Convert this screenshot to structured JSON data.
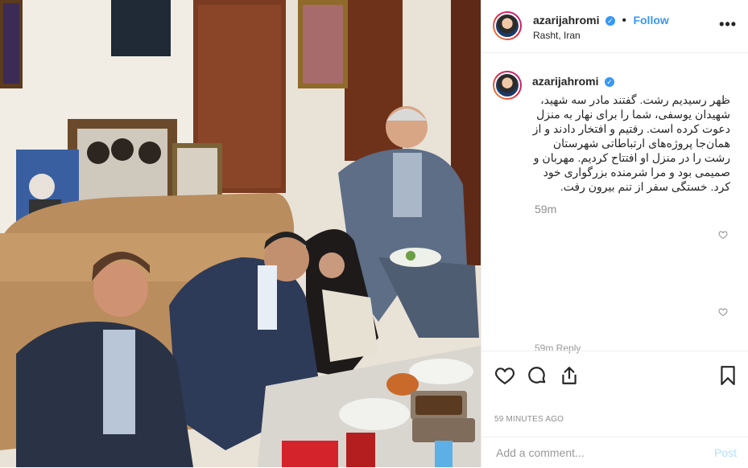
{
  "post": {
    "username": "azarijahromi",
    "location": "Rasht, Iran",
    "follow_label": "Follow",
    "dot": "•",
    "more_label": "•••",
    "caption": "ظهر رسیدیم رشت. گفتند مادر سه شهید، شهیدان یوسفی، شما را برای نهار به منزل دعوت کرده است. رفتیم و افتخار دادند و از همان‌جا پروژه‌های ارتباطاتی شهرستان رشت را در منزل او افتتاح کردیم. مهربان و صمیمی بود و مرا شرمنده بزرگواری خود کرد. خستگی سفر از تنم بیرون رفت.",
    "caption_time": "59m",
    "partial_comment": "59m    Reply",
    "timestamp": "59 MINUTES AGO",
    "comment_placeholder": "Add a comment...",
    "post_label": "Post"
  },
  "icons": {
    "verified": "verified-badge-icon",
    "like": "heart-icon",
    "comment": "comment-bubble-icon",
    "share": "share-icon",
    "save": "bookmark-icon"
  },
  "colors": {
    "accent": "#3897f0",
    "muted": "#8e8e8e",
    "post_disabled": "#b2dffc"
  }
}
